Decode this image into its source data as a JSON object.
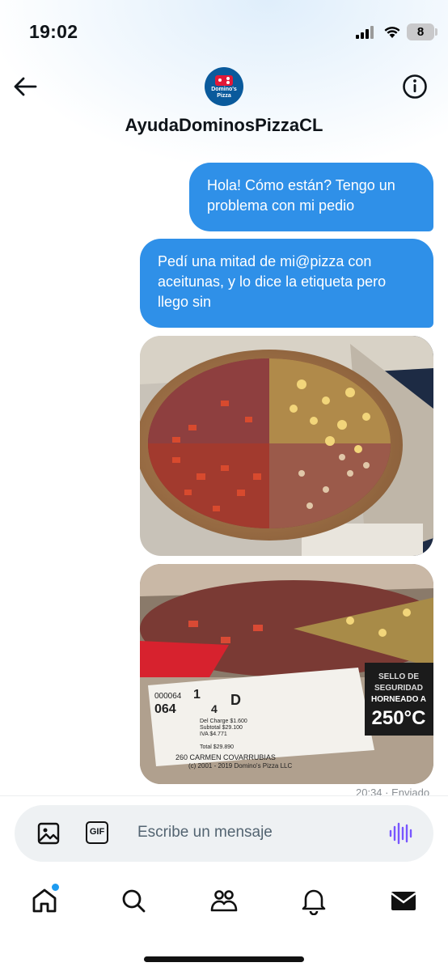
{
  "status_bar": {
    "time": "19:02",
    "battery": "8"
  },
  "header": {
    "account_name": "AyudaDominosPizzaCL",
    "avatar_text": "Domino's Pizza"
  },
  "messages": [
    {
      "text": "Hola! Cómo están? Tengo un problema con mi pedio"
    },
    {
      "text": "Pedí una mitad de mi@pizza con aceitunas, y lo dice la etiqueta pero llego sin"
    }
  ],
  "photos": [
    {
      "kind": "pizza-photo"
    },
    {
      "kind": "pizza-label-photo",
      "label_lines": [
        "000064",
        "064",
        "1",
        "4",
        "D",
        "Del Charge $1.600",
        "Subtotal $29.100",
        "IVA $4.771",
        "Total $29.890",
        "260 CARMEN COVARRUBIAS",
        "(c) 2001 - 2019 Domino's Pizza LLC",
        "SELLO DE",
        "SEGURIDAD",
        "HORNEADO A",
        "250°C"
      ]
    }
  ],
  "message_meta": "20:34 · Enviado",
  "composer": {
    "placeholder": "Escribe un mensaje",
    "gif_label": "GIF"
  },
  "tabs": [
    "home",
    "search",
    "communities",
    "notifications",
    "messages"
  ],
  "colors": {
    "bubble": "#2f90e8",
    "accent": "#1d9bf0",
    "voice": "#7856ff"
  }
}
